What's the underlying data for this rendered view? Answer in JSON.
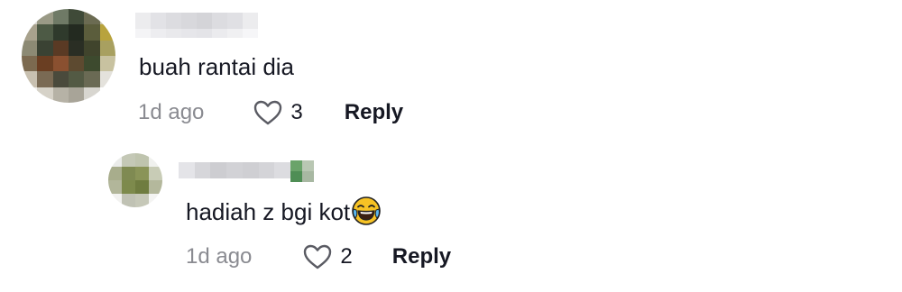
{
  "comments": [
    {
      "text": "buah rantai dia",
      "time": "1d ago",
      "likes": "3",
      "reply_label": "Reply",
      "avatar_icon": "blurred-avatar-icon",
      "username_blurred": true
    },
    {
      "text": "hadiah z bgi kot",
      "emoji": "😂",
      "time": "1d ago",
      "likes": "2",
      "reply_label": "Reply",
      "avatar_icon": "blurred-avatar-icon",
      "username_blurred": true
    }
  ],
  "icons": {
    "like": "heart-outline-icon",
    "emoji": "face-with-tears-of-joy-icon"
  },
  "colors": {
    "text": "#161823",
    "muted": "#8a8b91",
    "background": "#ffffff"
  }
}
